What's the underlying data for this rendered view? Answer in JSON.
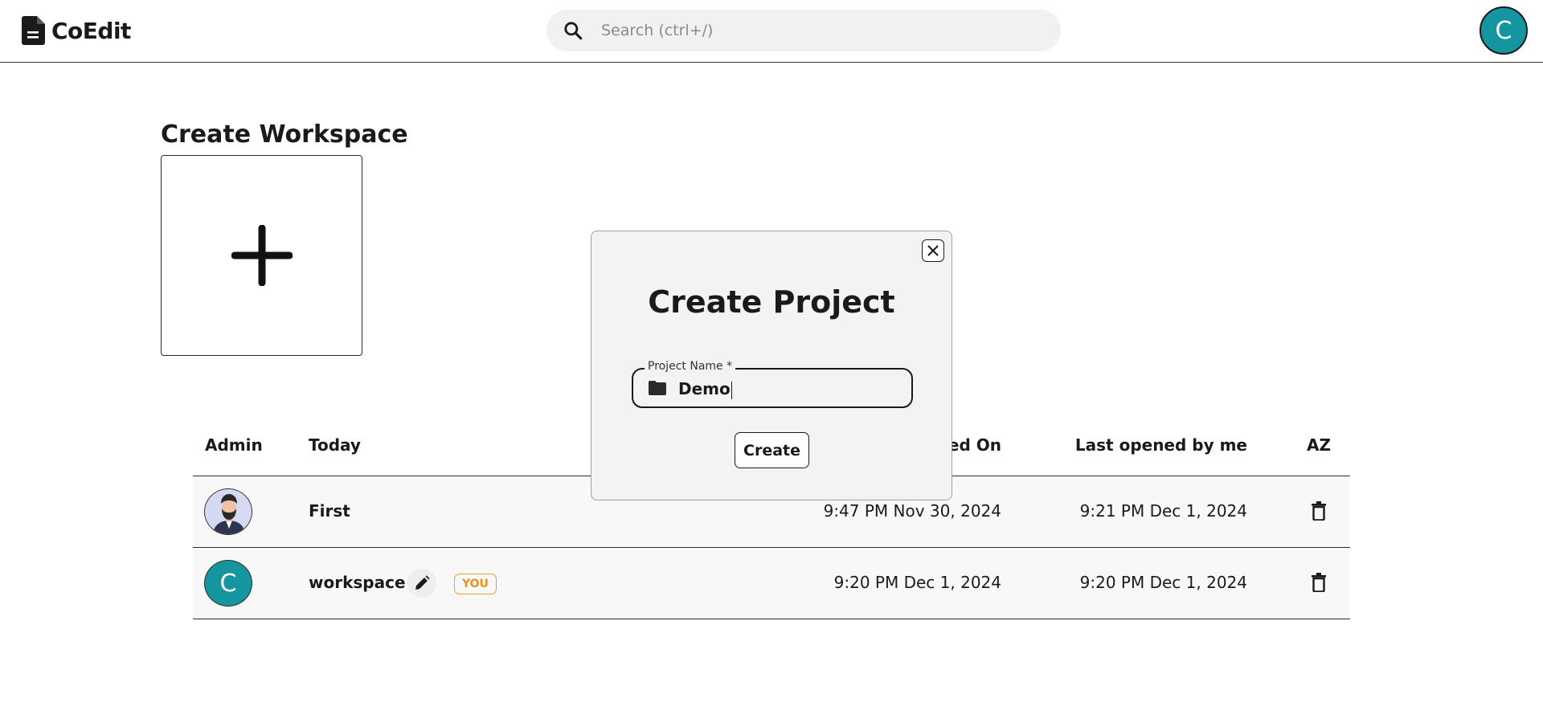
{
  "header": {
    "app_name": "CoEdit",
    "search_placeholder": "Search (ctrl+/)",
    "user_initial": "C"
  },
  "create_workspace": {
    "title": "Create Workspace"
  },
  "table": {
    "columns": {
      "admin": "Admin",
      "name": "Today",
      "created": "Created On",
      "last_opened": "Last opened by me",
      "sort": "AZ"
    },
    "rows": [
      {
        "name": "First",
        "created": "9:47 PM Nov 30, 2024",
        "last_opened": "9:21 PM Dec 1, 2024"
      },
      {
        "name": "workspace",
        "admin_initial": "C",
        "badge": "YOU",
        "created": "9:20 PM Dec 1, 2024",
        "last_opened": "9:20 PM Dec 1, 2024"
      }
    ]
  },
  "modal": {
    "title": "Create Project",
    "field_label": "Project Name *",
    "field_value": "Demo",
    "submit_label": "Create"
  },
  "colors": {
    "avatar": "#15959f",
    "badge": "#f0a020",
    "modal_bg": "#f3f3f3"
  },
  "icons": [
    "file-icon",
    "search-icon",
    "plus-icon",
    "close-icon",
    "folder-icon",
    "edit-icon",
    "trash-icon",
    "sort-az-icon"
  ]
}
